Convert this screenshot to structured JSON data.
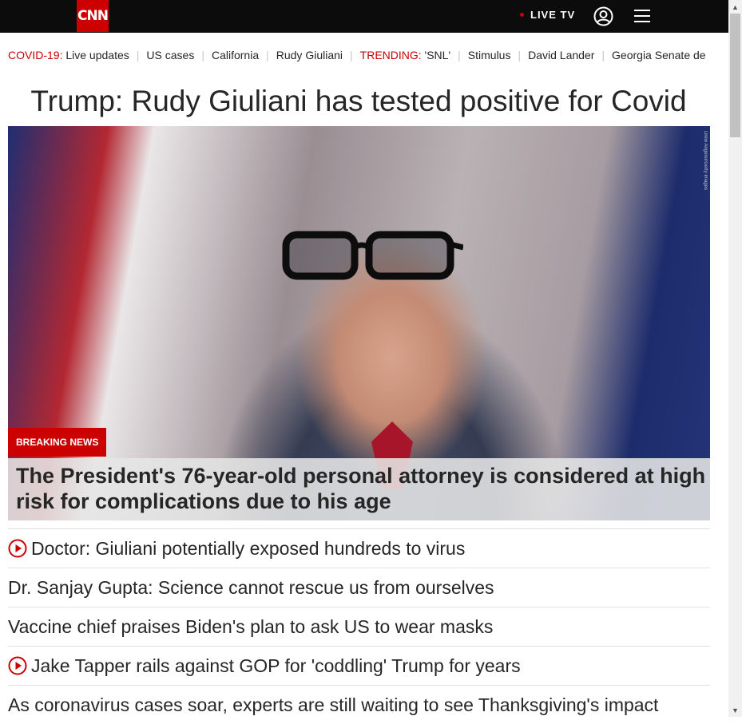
{
  "header": {
    "logo_text": "CNN",
    "live_tv": "LIVE TV",
    "user_icon": "user-account-icon",
    "menu_icon": "hamburger-menu-icon"
  },
  "nav": {
    "covid_label": "COVID-19:",
    "covid_items": [
      "Live updates",
      "US cases",
      "California",
      "Rudy Giuliani"
    ],
    "trending_label": "TRENDING:",
    "trending_items": [
      "'SNL'",
      "Stimulus",
      "David Lander",
      "Georgia Senate de"
    ]
  },
  "headline": "Trump: Rudy Giuliani has tested positive for Covid",
  "hero": {
    "badge": "BREAKING NEWS",
    "caption": "The President's 76-year-old personal attorney is considered at high risk for complications due to his age",
    "photo_credit": "Drew Angerer/Getty Images"
  },
  "links": [
    {
      "text": "Doctor: Giuliani potentially exposed hundreds to virus",
      "video": true
    },
    {
      "text": "Dr. Sanjay Gupta: Science cannot rescue us from ourselves",
      "video": false
    },
    {
      "text": "Vaccine chief praises Biden's plan to ask US to wear masks",
      "video": false
    },
    {
      "text": "Jake Tapper rails against GOP for 'coddling' Trump for years",
      "video": true
    },
    {
      "text": "As coronavirus cases soar, experts are still waiting to see Thanksgiving's impact",
      "video": false
    }
  ],
  "colors": {
    "accent": "#cc0000",
    "topbar": "#0c0c0c",
    "text": "#262626"
  }
}
